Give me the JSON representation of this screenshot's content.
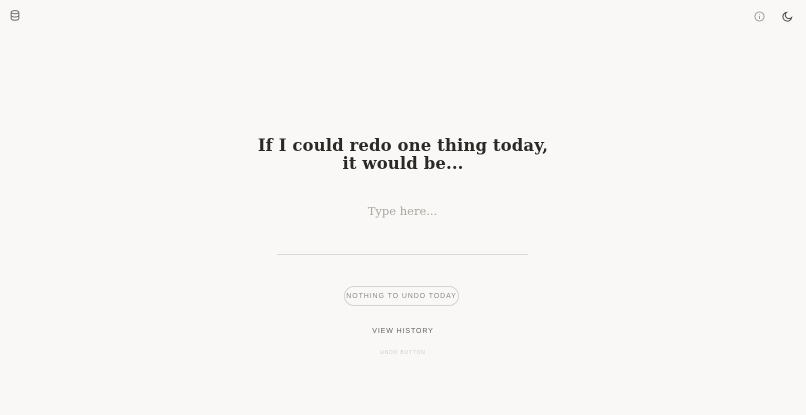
{
  "header": {
    "left_icon": "database-icon",
    "right_icons": [
      "info-icon",
      "moon-icon"
    ]
  },
  "main": {
    "prompt_line1": "If I could redo one thing today,",
    "prompt_line2": "it would be...",
    "input_value": "",
    "input_placeholder": "Type here...",
    "undo_button_label": "NOTHING TO UNDO TODAY",
    "history_link_label": "VIEW HISTORY",
    "caption": "UNDO BUTTON"
  },
  "colors": {
    "background": "#f9f8f6",
    "text": "#2b2926",
    "muted": "#8f8b86",
    "border": "#d6d3ce"
  }
}
